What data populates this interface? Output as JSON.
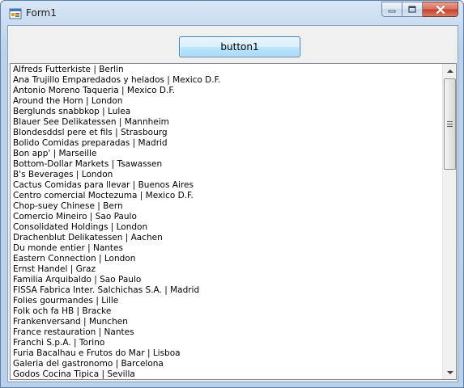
{
  "window": {
    "title": "Form1",
    "icons": [
      "app-icon",
      "minimize-icon",
      "maximize-icon",
      "close-icon"
    ]
  },
  "toolbar": {
    "button1_label": "button1"
  },
  "colors": {
    "close_button": "#c2412c",
    "button_border": "#3c7fb1",
    "titlebar": "#bcd2ea"
  },
  "listbox": {
    "items": [
      "Alfreds Futterkiste | Berlin",
      "Ana Trujillo Emparedados y helados | Mexico D.F.",
      "Antonio Moreno Taqueria | Mexico D.F.",
      "Around the Horn | London",
      "Berglunds snabbkop | Lulea",
      "Blauer See Delikatessen | Mannheim",
      "Blondesddsl pere et fils | Strasbourg",
      "Bolido Comidas preparadas | Madrid",
      "Bon app' | Marseille",
      "Bottom-Dollar Markets | Tsawassen",
      "B's Beverages | London",
      "Cactus Comidas para llevar | Buenos Aires",
      "Centro comercial Moctezuma | Mexico D.F.",
      "Chop-suey Chinese | Bern",
      "Comercio Mineiro | Sao Paulo",
      "Consolidated Holdings | London",
      "Drachenblut Delikatessen | Aachen",
      "Du monde entier | Nantes",
      "Eastern Connection | London",
      "Ernst Handel | Graz",
      "Familia Arquibaldo | Sao Paulo",
      "FISSA Fabrica Inter. Salchichas S.A. | Madrid",
      "Folies gourmandes | Lille",
      "Folk och fa HB | Bracke",
      "Frankenversand | Munchen",
      "France restauration | Nantes",
      "Franchi S.p.A. | Torino",
      "Furia Bacalhau e Frutos do Mar | Lisboa",
      "Galeria del gastronomo | Barcelona",
      "Godos Cocina Tipica | Sevilla"
    ]
  }
}
